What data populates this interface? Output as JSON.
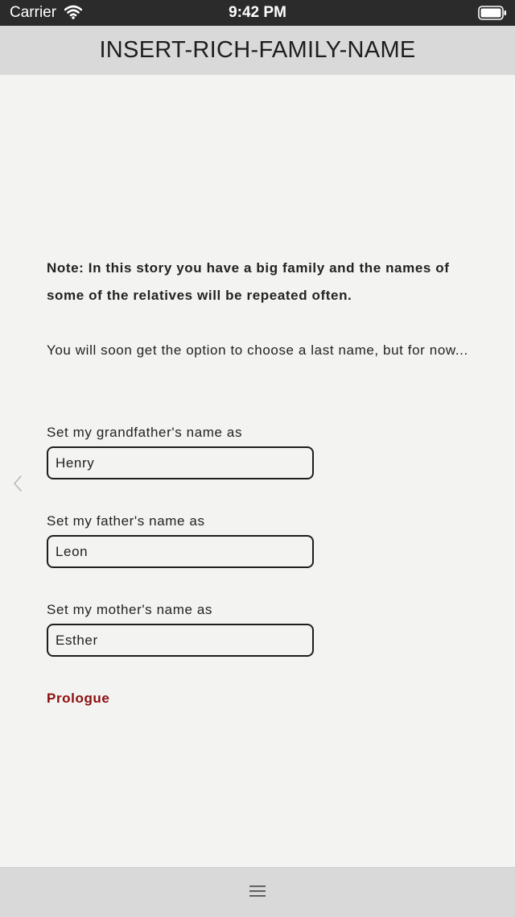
{
  "status_bar": {
    "carrier": "Carrier",
    "time": "9:42 PM"
  },
  "header": {
    "title": "INSERT-RICH-FAMILY-NAME"
  },
  "content": {
    "note": "Note: In this story you have a big family and the names of some of the relatives will be repeated often.",
    "intro": "You will soon get the option to choose a last name, but for now...",
    "fields": [
      {
        "label": "Set my grandfather's name as",
        "value": "Henry"
      },
      {
        "label": "Set my father's name as",
        "value": "Leon"
      },
      {
        "label": "Set my mother's name as",
        "value": "Esther"
      }
    ],
    "prologue_link": "Prologue"
  },
  "icons": {
    "wifi": "wifi-icon",
    "battery": "battery-icon",
    "back": "chevron-left-icon",
    "menu": "hamburger-menu-icon"
  },
  "colors": {
    "link": "#8b0e0e",
    "header_bg": "#d9d9d9",
    "page_bg": "#f3f3f1",
    "status_bg": "#2b2b2b"
  }
}
